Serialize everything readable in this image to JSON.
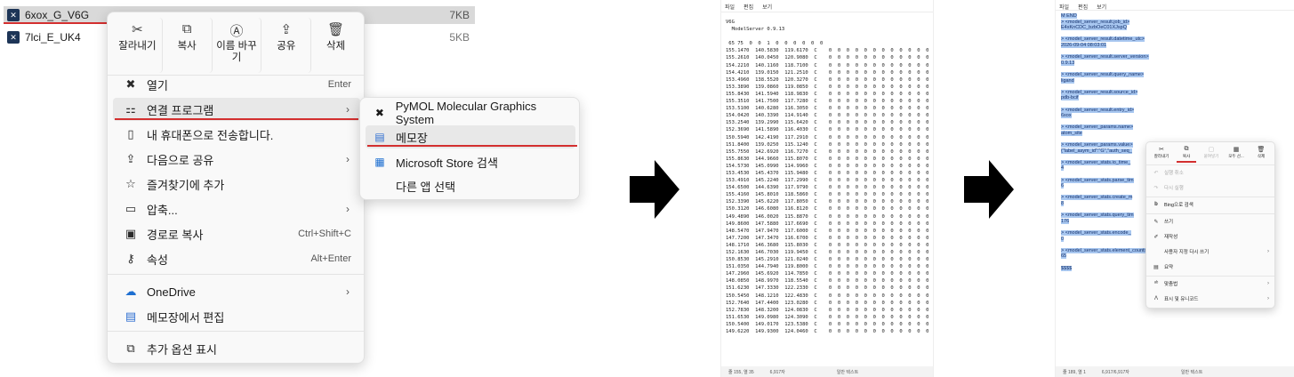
{
  "explorer": {
    "files": [
      {
        "name": "6xox_G_V6G",
        "size": "7KB"
      },
      {
        "name": "7lci_E_UK4",
        "size": "5KB"
      }
    ]
  },
  "context_menu": {
    "top_actions": [
      {
        "label": "잘라내기",
        "icon": "scissors-icon"
      },
      {
        "label": "복사",
        "icon": "copy-icon"
      },
      {
        "label": "이름 바꾸기",
        "icon": "rename-icon"
      },
      {
        "label": "공유",
        "icon": "share-icon"
      },
      {
        "label": "삭제",
        "icon": "trash-icon"
      }
    ],
    "items": [
      {
        "label": "열기",
        "shortcut": "Enter",
        "icon": "pymol-app-icon"
      },
      {
        "label": "연결 프로그램",
        "icon": "open-with-icon",
        "chevron": "›"
      },
      {
        "label": "내 휴대폰으로 전송합니다.",
        "icon": "phone-icon"
      },
      {
        "label": "다음으로 공유",
        "icon": "share-icon",
        "chevron": "›"
      },
      {
        "label": "즐겨찾기에 추가",
        "icon": "star-icon"
      },
      {
        "label": "압축...",
        "icon": "archive-icon",
        "chevron": "›"
      },
      {
        "label": "경로로 복사",
        "shortcut": "Ctrl+Shift+C",
        "icon": "copy-path-icon"
      },
      {
        "label": "속성",
        "shortcut": "Alt+Enter",
        "icon": "properties-icon"
      },
      {
        "label": "OneDrive",
        "icon": "onedrive-icon",
        "chevron": "›"
      },
      {
        "label": "메모장에서 편집",
        "icon": "notepad-icon"
      },
      {
        "label": "추가 옵션 표시",
        "icon": "more-options-icon"
      }
    ]
  },
  "open_with_submenu": {
    "items": [
      {
        "label": "PyMOL Molecular Graphics System",
        "icon": "pymol-app-icon"
      },
      {
        "label": "메모장",
        "icon": "notepad-icon"
      },
      {
        "label": "Microsoft Store 검색",
        "icon": "store-icon"
      },
      {
        "label": "다른 앱 선택",
        "icon": ""
      }
    ]
  },
  "notepad1": {
    "menu": [
      "파일",
      "편집",
      "보기"
    ],
    "header_lines": [
      "V6G",
      "  ModelServer 0.9.13",
      "",
      " 65 75  0  0  1  0  0  0  0  0  0"
    ],
    "coord_lines": [
      "155.1470  140.5830  119.6170  C    0  0  0  0  0  0  0  0  0  0  0  0",
      "155.2610  140.0450  120.9080  C    0  0  0  0  0  0  0  0  0  0  0  0",
      "154.2210  140.1160  118.7100  C    0  0  0  0  0  0  0  0  0  0  0  0",
      "154.4210  139.0150  121.2510  C    0  0  0  0  0  0  0  0  0  0  0  0",
      "153.4960  138.5520  120.3270  C    0  0  0  0  0  0  0  0  0  0  0  0",
      "153.3890  139.0860  119.0850  C    0  0  0  0  0  0  0  0  0  0  0  0",
      "155.8430  141.5940  118.9830  C    0  0  0  0  0  0  0  0  0  0  0  0",
      "155.3510  141.7500  117.7280  C    0  0  0  0  0  0  0  0  0  0  0  0",
      "153.5100  140.6280  116.3050  C    0  0  0  0  0  0  0  0  0  0  0  0",
      "154.0420  140.3390  114.9140  C    0  0  0  0  0  0  0  0  0  0  0  0",
      "153.2540  139.2990  115.6420  C    0  0  0  0  0  0  0  0  0  0  0  0",
      "152.3690  141.5890  116.4030  C    0  0  0  0  0  0  0  0  0  0  0  0",
      "150.5940  142.4190  117.2910  C    0  0  0  0  0  0  0  0  0  0  0  0",
      "151.8400  139.0250  115.1240  C    0  0  0  0  0  0  0  0  0  0  0  0",
      "155.7550  142.6920  116.7270  C    0  0  0  0  0  0  0  0  0  0  0  0",
      "155.8630  144.9660  115.8070  C    0  0  0  0  0  0  0  0  0  0  0  0",
      "154.5730  145.0990  114.9960  C    0  0  0  0  0  0  0  0  0  0  0  0",
      "153.4530  145.4370  115.9480  C    0  0  0  0  0  0  0  0  0  0  0  0",
      "153.4910  145.2240  117.2990  C    0  0  0  0  0  0  0  0  0  0  0  0",
      "154.6500  144.6390  117.9790  C    0  0  0  0  0  0  0  0  0  0  0  0",
      "155.4160  145.8010  118.5860  C    0  0  0  0  0  0  0  0  0  0  0  0",
      "152.3390  145.6220  117.8050  C    0  0  0  0  0  0  0  0  0  0  0  0",
      "150.3120  146.6080  116.8120  C    0  0  0  0  0  0  0  0  0  0  0  0",
      "149.4890  146.0020  115.8870  C    0  0  0  0  0  0  0  0  0  0  0  0",
      "149.8600  147.5880  117.6690  C    0  0  0  0  0  0  0  0  0  0  0  0",
      "148.5470  147.9470  117.6000  C    0  0  0  0  0  0  0  0  0  0  0  0",
      "147.7200  147.3470  116.6700  C    0  0  0  0  0  0  0  0  0  0  0  0",
      "148.1710  146.3680  115.8030  C    0  0  0  0  0  0  0  0  0  0  0  0",
      "152.1630  146.7030  119.9450  C    0  0  0  0  0  0  0  0  0  0  0  0",
      "150.8530  145.2910  121.0240  C    0  0  0  0  0  0  0  0  0  0  0  0",
      "151.0350  144.7940  119.8000  C    0  0  0  0  0  0  0  0  0  0  0  0",
      "147.2960  145.6920  114.7850  C    0  0  0  0  0  0  0  0  0  0  0  0",
      "148.0850  148.9970  118.5540  C    0  0  0  0  0  0  0  0  0  0  0  0",
      "151.6230  147.3330  122.2330  C    0  0  0  0  0  0  0  0  0  0  0  0",
      "150.5450  148.1210  122.4830  C    0  0  0  0  0  0  0  0  0  0  0  0",
      "152.7640  147.4400  123.0280  C    0  0  0  0  0  0  0  0  0  0  0  0",
      "152.7830  148.3200  124.0830  C    0  0  0  0  0  0  0  0  0  0  0  0",
      "151.6530  149.0980  124.3090  C    0  0  0  0  0  0  0  0  0  0  0  0",
      "150.5400  149.0170  123.5380  C    0  0  0  0  0  0  0  0  0  0  0  0",
      "149.6220  149.9300  124.0460  C    0  0  0  0  0  0  0  0  0  0  0  0"
    ],
    "status": [
      "줄 155, 열 35",
      "6,917자",
      "일반 텍스트"
    ]
  },
  "notepad2": {
    "menu": [
      "파일",
      "편집",
      "보기"
    ],
    "lines": [
      "M  END",
      "> <model_server_result.job_id>",
      "E4xKnCDC_bzbOeC01XJspQ",
      "",
      "> <model_server_result.datetime_utc>",
      "2026-09-04 08:03:01",
      "",
      "> <model_server_result.server_version>",
      "0.9.13",
      "",
      "> <model_server_result.query_name>",
      "ligand",
      "",
      "> <model_server_result.source_id>",
      "pdb-bcif",
      "",
      "> <model_server_result.entry_id>",
      "6xox",
      "",
      "> <model_server_params.name>",
      "atom_site",
      "",
      "> <model_server_params.value>",
      "{\"label_asym_id\":\"G\",\"auth_seq_",
      "",
      "> <model_server_stats.io_time_",
      "4",
      "",
      "> <model_server_stats.parse_tim",
      "6",
      "",
      "> <model_server_stats.create_m",
      "8",
      "",
      "> <model_server_stats.query_tim",
      "176",
      "",
      "> <model_server_stats.encode_",
      "0",
      "",
      "> <model_server_stats.element_count>",
      "65",
      "",
      "$$$$"
    ],
    "context_menu": {
      "top": [
        {
          "label": "잘라내기",
          "icon": "scissors-icon",
          "enabled": true
        },
        {
          "label": "복사",
          "icon": "copy-icon",
          "enabled": true
        },
        {
          "label": "붙여넣기",
          "icon": "paste-icon",
          "enabled": false
        },
        {
          "label": "모두 선...",
          "icon": "select-all-icon",
          "enabled": true
        },
        {
          "label": "삭제",
          "icon": "trash-icon",
          "enabled": true
        }
      ],
      "items": [
        {
          "label": "실행 취소",
          "icon": "undo-icon",
          "enabled": false
        },
        {
          "label": "다시 실행",
          "icon": "redo-icon",
          "enabled": false
        },
        {
          "label": "Bing으로 검색",
          "icon": "bing-icon",
          "enabled": true
        },
        {
          "label": "쓰기",
          "icon": "write-icon",
          "enabled": true
        },
        {
          "label": "재작성",
          "icon": "rewrite-icon",
          "enabled": true
        },
        {
          "label": "사용자 지정 다시 쓰기",
          "icon": "",
          "enabled": true,
          "chevron": "›"
        },
        {
          "label": "요약",
          "icon": "summarize-icon",
          "enabled": true
        },
        {
          "label": "맞춤법",
          "icon": "spellcheck-icon",
          "enabled": true,
          "chevron": "›"
        },
        {
          "label": "표시 및 유니코드",
          "icon": "unicode-icon",
          "enabled": true,
          "chevron": "›"
        }
      ]
    },
    "status": [
      "줄 189, 열 1",
      "6,917/6,917자",
      "일반 텍스트"
    ]
  },
  "colors": {
    "accent_red": "#d32f2f",
    "selection_blue": "#a8c7f0"
  }
}
